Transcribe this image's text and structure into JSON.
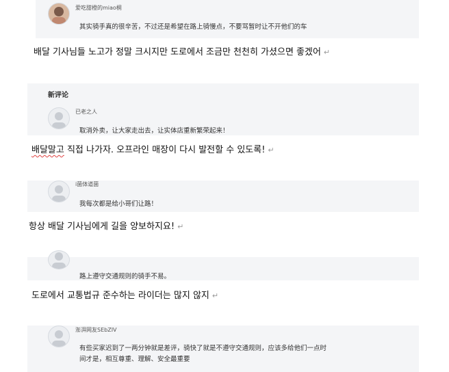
{
  "comments": [
    {
      "username": "爱吃甜橙的miao桐",
      "text": "其实骑手真的很辛苦，不过还是希望在路上骑慢点，不要骂暂时让不开他们的车"
    },
    {
      "username": "已老之人",
      "text": "取消外卖，让大家走出去，让实体店重新繁荣起来！"
    },
    {
      "username": "i菌体道菌",
      "text": "我每次都是给小哥们让路！"
    },
    {
      "username": "",
      "text": "路上遵守交通规则的骑手不易。"
    },
    {
      "username": "澎湃网友SEbZIV",
      "text_line1": "有些买家迟到了一两分钟就是差评，骑快了就是不遵守交通规则，应该多给他们一点时",
      "text_line2": "间才是，相互尊重、理解、安全最重要"
    }
  ],
  "section": {
    "title": "新评论"
  },
  "translations": {
    "t1": "배달 기사님들 노고가 정말 크시지만 도로에서 조금만 천천히 가셨으면 좋겠어",
    "t2_part1": "배달말고",
    "t2_part2": " 직접 나가자. 오프라인 매장이 다시 발전할 수 있도록!",
    "t3": "항상 배달 기사님에게 길을 양보하지요!",
    "t4": "도로에서 교통법규 준수하는 라이더는 많지 않지"
  },
  "return_mark": "↵"
}
